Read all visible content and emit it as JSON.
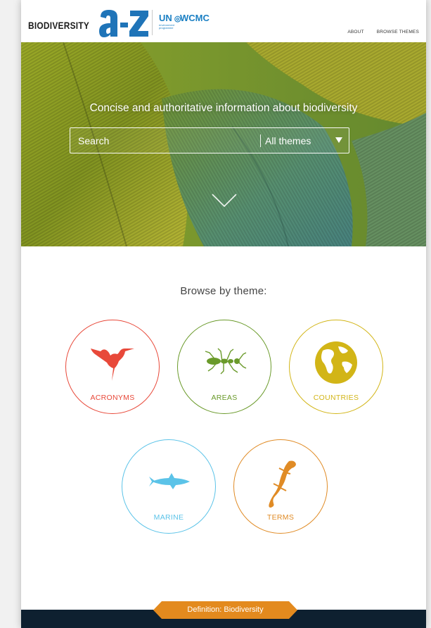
{
  "header": {
    "logo_word": "BIODIVERSITY",
    "logo_az": "a-Z",
    "partner_un": "UN",
    "partner_un_sub": "environment programme",
    "partner_wcmc": "WCMC",
    "nav": [
      "ABOUT",
      "BROWSE THEMES"
    ]
  },
  "hero": {
    "tagline": "Concise and authoritative information about biodiversity",
    "search_placeholder": "Search",
    "theme_select_value": "All themes"
  },
  "browse": {
    "title": "Browse by theme:",
    "themes": [
      {
        "label": "ACRONYMS",
        "color": "#e8493a",
        "icon": "hummingbird-icon"
      },
      {
        "label": "AREAS",
        "color": "#6a9a2a",
        "icon": "ant-icon"
      },
      {
        "label": "COUNTRIES",
        "color": "#d2b517",
        "icon": "globe-icon"
      },
      {
        "label": "MARINE",
        "color": "#5bc3e8",
        "icon": "shark-icon"
      },
      {
        "label": "TERMS",
        "color": "#e08b25",
        "icon": "salamander-icon"
      }
    ]
  },
  "footer": {
    "definition_tab": "Definition: Biodiversity",
    "tab_color": "#e38a1e",
    "band_color": "#0e2030"
  }
}
